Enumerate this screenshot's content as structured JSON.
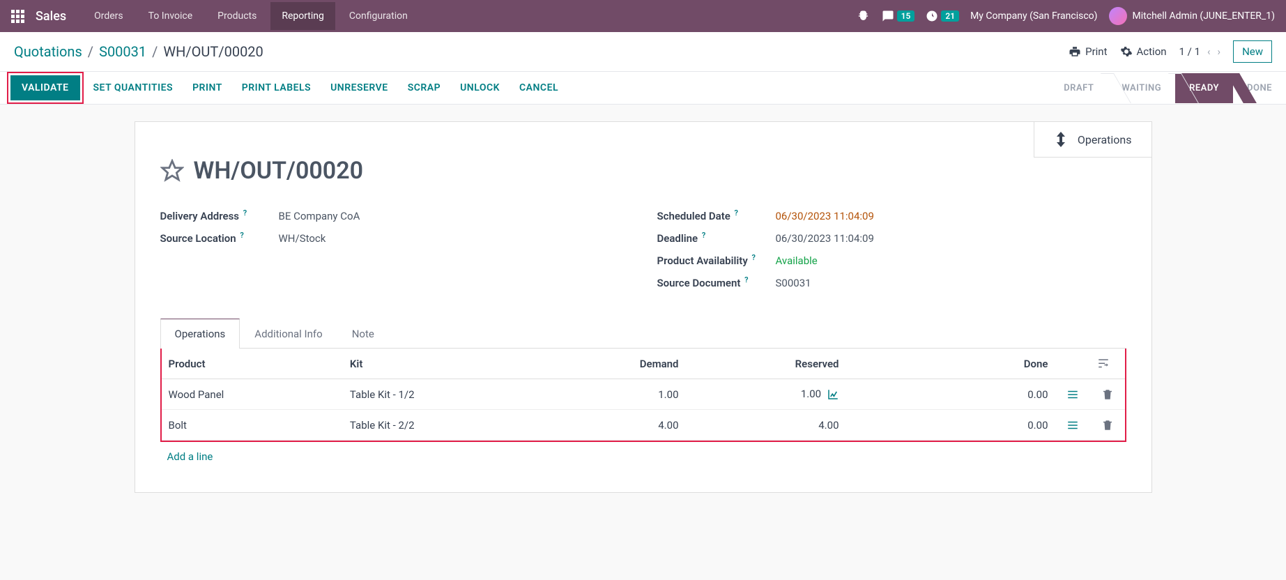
{
  "topbar": {
    "app_name": "Sales",
    "nav": [
      "Orders",
      "To Invoice",
      "Products",
      "Reporting",
      "Configuration"
    ],
    "active_nav_index": 3,
    "messages_badge": "15",
    "activities_badge": "21",
    "company": "My Company (San Francisco)",
    "user": "Mitchell Admin (JUNE_ENTER_1)"
  },
  "controlbar": {
    "breadcrumb": [
      "Quotations",
      "S00031",
      "WH/OUT/00020"
    ],
    "print": "Print",
    "action": "Action",
    "pager": "1 / 1",
    "new": "New"
  },
  "actionbar": {
    "validate": "VALIDATE",
    "buttons": [
      "SET QUANTITIES",
      "PRINT",
      "PRINT LABELS",
      "UNRESERVE",
      "SCRAP",
      "UNLOCK",
      "CANCEL"
    ],
    "statuses": [
      "DRAFT",
      "WAITING",
      "READY",
      "DONE"
    ],
    "active_status_index": 2
  },
  "sheet": {
    "operations_btn": "Operations",
    "title": "WH/OUT/00020",
    "left_fields": [
      {
        "label": "Delivery Address",
        "value": "BE Company CoA"
      },
      {
        "label": "Source Location",
        "value": "WH/Stock"
      }
    ],
    "right_fields": [
      {
        "label": "Scheduled Date",
        "value": "06/30/2023 11:04:09",
        "class": "value-amber"
      },
      {
        "label": "Deadline",
        "value": "06/30/2023 11:04:09"
      },
      {
        "label": "Product Availability",
        "value": "Available",
        "class": "value-green"
      },
      {
        "label": "Source Document",
        "value": "S00031"
      }
    ],
    "tabs": [
      "Operations",
      "Additional Info",
      "Note"
    ],
    "table": {
      "headers": {
        "product": "Product",
        "kit": "Kit",
        "demand": "Demand",
        "reserved": "Reserved",
        "done": "Done"
      },
      "rows": [
        {
          "product": "Wood Panel",
          "kit": "Table Kit - 1/2",
          "demand": "1.00",
          "reserved": "1.00",
          "done": "0.00",
          "forecast": true
        },
        {
          "product": "Bolt",
          "kit": "Table Kit - 2/2",
          "demand": "4.00",
          "reserved": "4.00",
          "done": "0.00",
          "forecast": false
        }
      ],
      "add_line": "Add a line"
    }
  }
}
